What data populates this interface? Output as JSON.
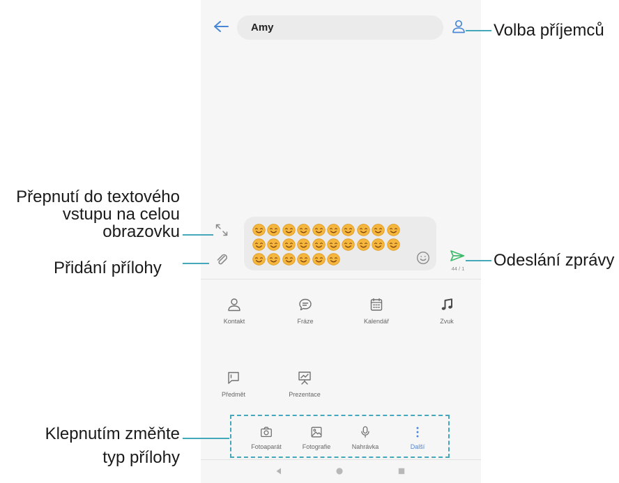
{
  "header": {
    "back_icon": "back-arrow-icon",
    "recipient": "Amy",
    "contacts_icon": "person-icon"
  },
  "composer": {
    "expand_icon": "expand-icon",
    "attach_icon": "paperclip-icon",
    "message_emoji": "smiling-face-emoji",
    "message_emoji_count": 26,
    "emoji_picker_icon": "smiley-icon",
    "send_icon": "send-icon",
    "counter": "44 / 1"
  },
  "attachment_options": [
    {
      "label": "Kontakt",
      "icon": "contact-icon"
    },
    {
      "label": "Fráze",
      "icon": "phrase-bubble-icon"
    },
    {
      "label": "Kalendář",
      "icon": "calendar-icon"
    },
    {
      "label": "Zvuk",
      "icon": "music-note-icon"
    },
    {
      "label": "Předmět",
      "icon": "subject-icon"
    },
    {
      "label": "Prezentace",
      "icon": "presentation-icon"
    }
  ],
  "attachment_tabs": [
    {
      "label": "Fotoaparát",
      "icon": "camera-icon",
      "active": false
    },
    {
      "label": "Fotografie",
      "icon": "image-icon",
      "active": false
    },
    {
      "label": "Nahrávka",
      "icon": "microphone-icon",
      "active": false
    },
    {
      "label": "Další",
      "icon": "more-icon",
      "active": true
    }
  ],
  "system_nav": [
    {
      "icon": "nav-back-icon"
    },
    {
      "icon": "nav-home-icon"
    },
    {
      "icon": "nav-recents-icon"
    }
  ],
  "callouts": {
    "recipient": "Volba příjemců",
    "fullscreen": [
      "Přepnutí do textového",
      "vstupu na celou",
      "obrazovku"
    ],
    "attachment": "Přidání přílohy",
    "send": "Odeslání zprávy",
    "attachment_type": [
      "Klepnutím změňte",
      "typ přílohy"
    ]
  },
  "colors": {
    "accent": "#4a86d6",
    "callout": "#45a7ba",
    "send": "#3dbb6b",
    "emoji": "#f4b63c"
  }
}
